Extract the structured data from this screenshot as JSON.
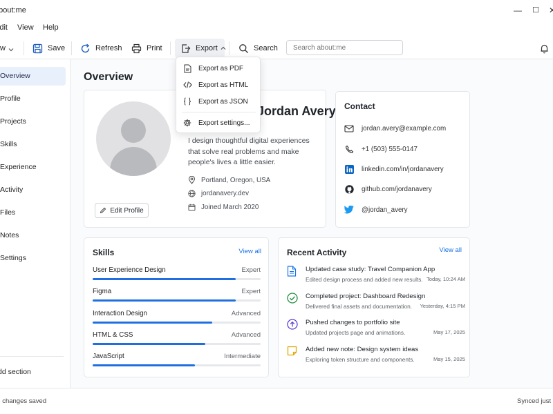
{
  "window": {
    "title": "about:me",
    "minimize": "—",
    "maximize": "☐",
    "close": "✕"
  },
  "menu": [
    "Edit",
    "View",
    "Help"
  ],
  "toolbar": {
    "new_label": "New",
    "save_label": "Save",
    "refresh_label": "Refresh",
    "print_label": "Print",
    "export_label": "Export",
    "search_label": "Search",
    "search_placeholder": "Search about:me"
  },
  "sidebar": {
    "items": [
      {
        "label": "Overview",
        "active": true
      },
      {
        "label": "Profile"
      },
      {
        "label": "Projects"
      },
      {
        "label": "Skills"
      },
      {
        "label": "Experience"
      },
      {
        "label": "Activity"
      },
      {
        "label": "Files"
      },
      {
        "label": "Notes"
      },
      {
        "label": "Settings"
      }
    ],
    "add_section": "Add section"
  },
  "main": {
    "title": "Overview",
    "profile": {
      "name": "Jordan Avery",
      "bio": "I design thoughtful digital experiences that solve real problems and make people's lives a little easier.",
      "location": "Portland, Oregon, USA",
      "website": "jordanavery.dev",
      "joined": "Joined March 2020",
      "edit_label": "Edit Profile"
    },
    "contact": {
      "title": "Contact",
      "email": "jordan.avery@example.com",
      "phone": "+1 (503) 555-0147",
      "linkedin": "linkedin.com/in/jordanavery",
      "github": "github.com/jordanavery",
      "twitter": "@jordan_avery"
    },
    "skills": {
      "title": "Skills",
      "view_all": "View all",
      "items": [
        {
          "name": "User Experience Design",
          "level": "Expert",
          "progress": 0.85
        },
        {
          "name": "Figma",
          "level": "Expert",
          "progress": 0.85
        },
        {
          "name": "Interaction Design",
          "level": "Advanced",
          "progress": 0.71
        },
        {
          "name": "HTML & CSS",
          "level": "Advanced",
          "progress": 0.67
        },
        {
          "name": "JavaScript",
          "level": "Intermediate",
          "progress": 0.61
        }
      ]
    },
    "activity": {
      "title": "Recent Activity",
      "view_all": "View all",
      "items": [
        {
          "title": "Updated case study: Travel Companion App",
          "desc": "Edited design process and added new results.",
          "time": "Today, 10:24 AM",
          "icon": "document-icon"
        },
        {
          "title": "Completed project: Dashboard Redesign",
          "desc": "Delivered final assets and documentation.",
          "time": "Yesterday, 4:15 PM",
          "icon": "check-circle-icon"
        },
        {
          "title": "Pushed changes to portfolio site",
          "desc": "Updated projects page and animations.",
          "time": "May 17, 2025",
          "icon": "upload-circle-icon"
        },
        {
          "title": "Added new note: Design system ideas",
          "desc": "Exploring token structure and components.",
          "time": "May 15, 2025",
          "icon": "note-icon"
        }
      ]
    }
  },
  "export_menu": {
    "items": [
      {
        "label": "Export as PDF",
        "icon": "pdf-file-icon"
      },
      {
        "label": "Export as HTML",
        "icon": "code-icon"
      },
      {
        "label": "Export as JSON",
        "icon": "braces-icon"
      },
      {
        "label": "Export settings...",
        "icon": "gear-icon"
      }
    ]
  },
  "status": {
    "left": "All changes saved",
    "right": "Synced just now"
  },
  "colors": {
    "accent": "#1a73e8",
    "progress": "#1f6fe0",
    "active_nav": "#e8f0fc",
    "linkedin": "#0a66c2",
    "twitter": "#1d9bf0",
    "check": "#1e8e3e",
    "upload": "#5b3fd6",
    "note": "#e0a800"
  }
}
